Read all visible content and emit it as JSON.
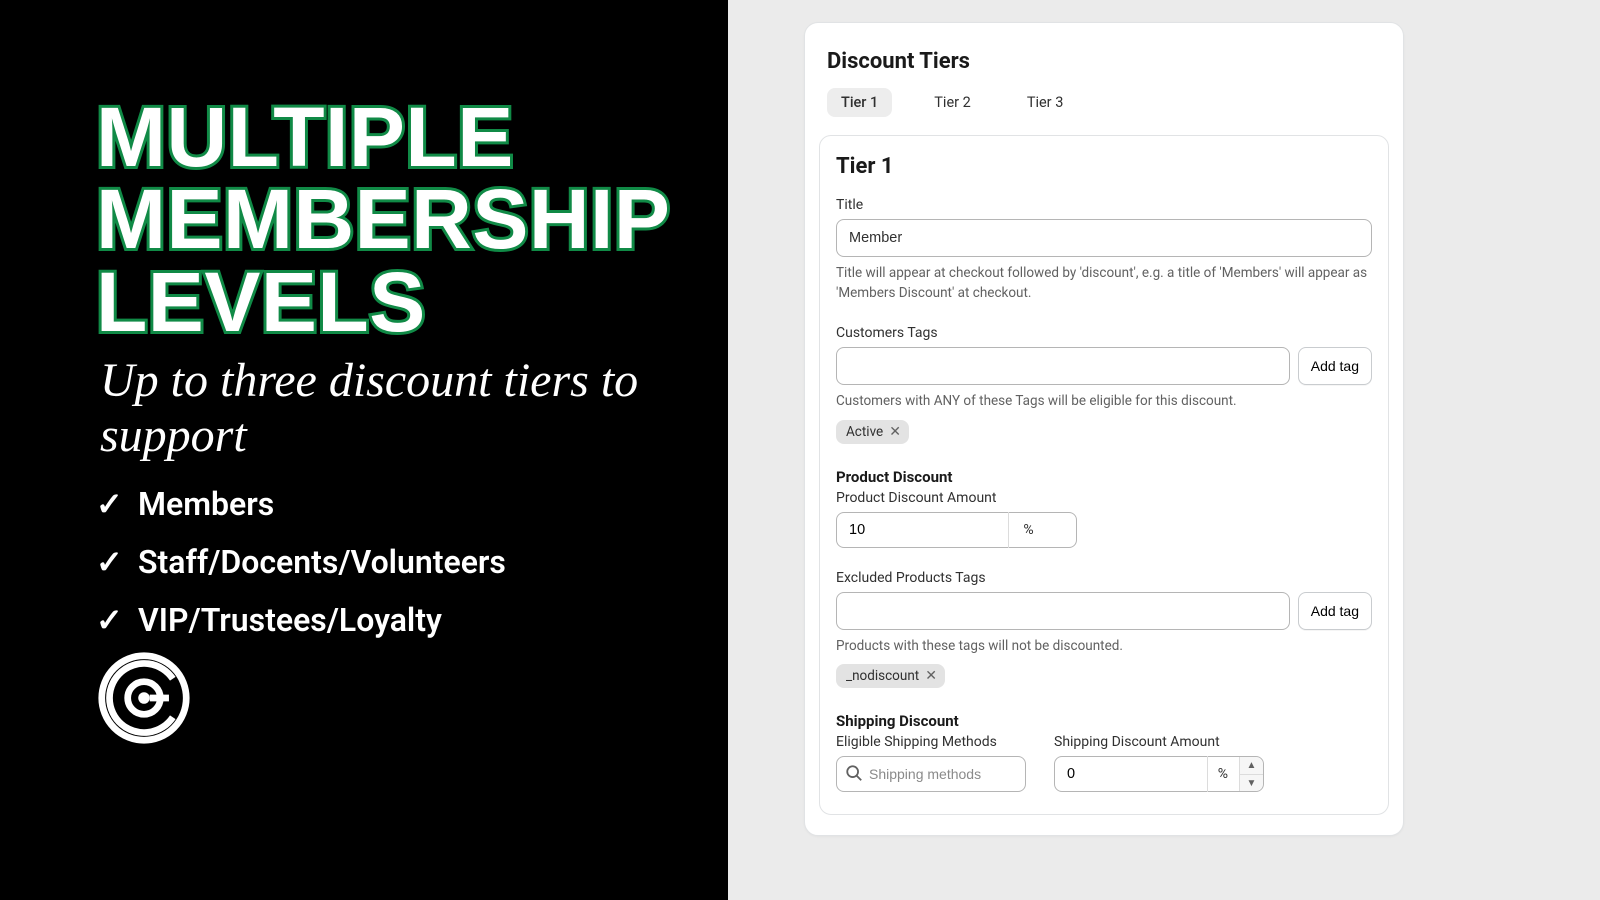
{
  "promo": {
    "headline_l1": "MULTIPLE",
    "headline_l2": "MEMBERSHIP",
    "headline_l3": "LEVELS",
    "subtitle": "Up to three discount tiers to support",
    "bullets": [
      "Members",
      "Staff/Docents/Volunteers",
      "VIP/Trustees/Loyalty"
    ]
  },
  "panel": {
    "title": "Discount Tiers",
    "tabs": [
      "Tier 1",
      "Tier 2",
      "Tier 3"
    ],
    "active_tab_index": 0,
    "tier_heading": "Tier 1",
    "title_field": {
      "label": "Title",
      "value": "Member",
      "help": "Title will appear at checkout followed by 'discount', e.g. a title of 'Members' will appear as 'Members Discount' at checkout."
    },
    "customer_tags": {
      "label": "Customers Tags",
      "add_btn": "Add tag",
      "help": "Customers with ANY of these Tags will be eligible for this discount.",
      "chips": [
        "Active"
      ]
    },
    "product_discount": {
      "section": "Product Discount",
      "amount_label": "Product Discount Amount",
      "amount_value": "10",
      "suffix": "%"
    },
    "excluded_tags": {
      "label": "Excluded Products Tags",
      "add_btn": "Add tag",
      "help": "Products with these tags will not be discounted.",
      "chips": [
        "_nodiscount"
      ]
    },
    "shipping": {
      "section": "Shipping Discount",
      "methods_label": "Eligible Shipping Methods",
      "methods_placeholder": "Shipping methods",
      "amount_label": "Shipping Discount Amount",
      "amount_value": "0",
      "suffix": "%"
    }
  }
}
